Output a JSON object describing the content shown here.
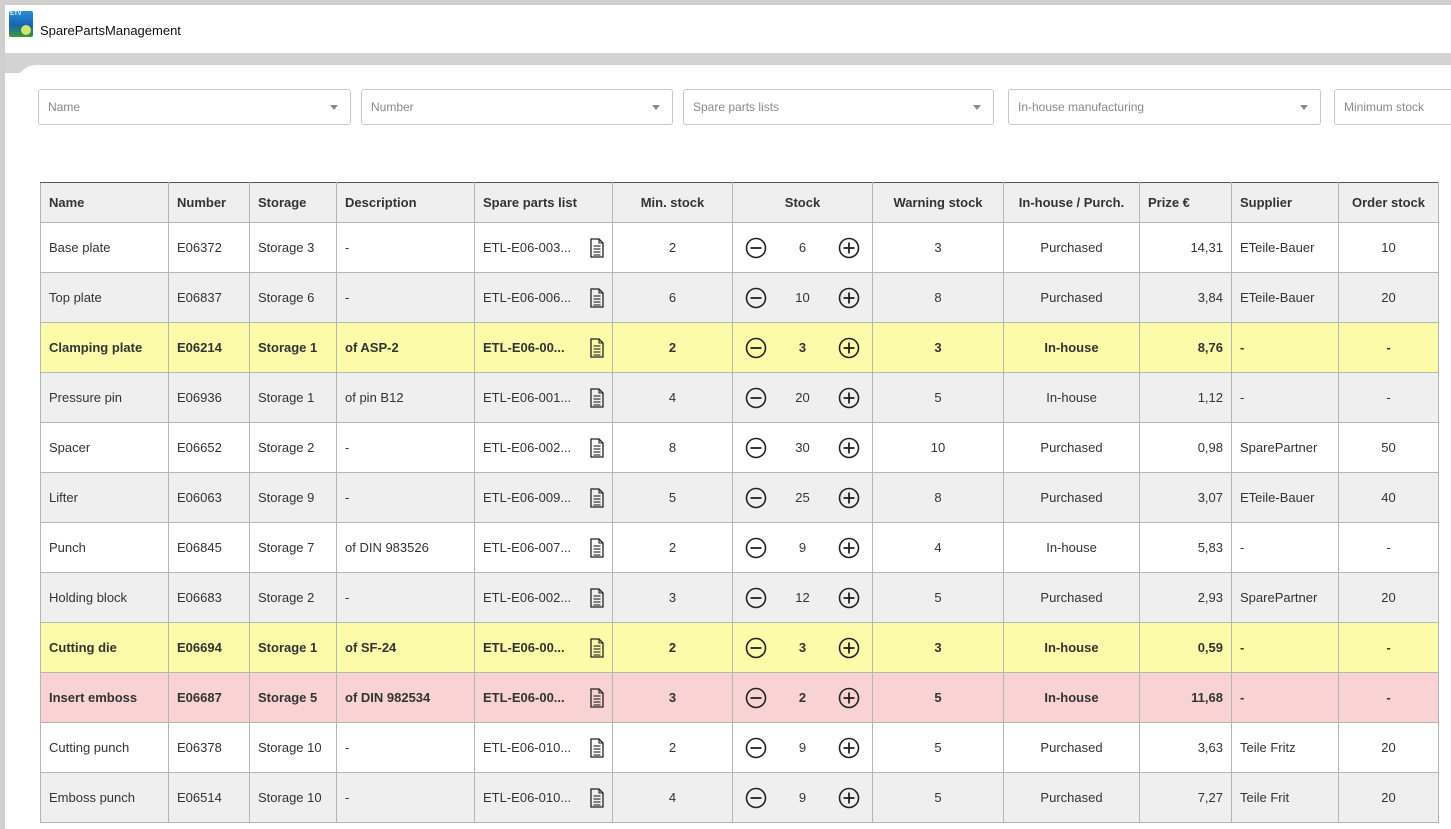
{
  "app": {
    "title": "SparePartsManagement",
    "icon_text": "ETV"
  },
  "filters": [
    {
      "placeholder": "Name"
    },
    {
      "placeholder": "Number"
    },
    {
      "placeholder": "Spare parts lists"
    },
    {
      "placeholder": "In-house manufacturing"
    },
    {
      "placeholder": "Minimum stock"
    }
  ],
  "table": {
    "headers": [
      "Name",
      "Number",
      "Storage",
      "Description",
      "Spare parts list",
      "Min. stock",
      "Stock",
      "Warning stock",
      "In-house / Purch.",
      "Prize €",
      "Supplier",
      "Order stock"
    ],
    "rows": [
      {
        "name": "Base plate",
        "number": "E06372",
        "storage": "Storage 3",
        "description": "-",
        "list": "ETL-E06-003...",
        "min": "2",
        "stock": "6",
        "warning": "3",
        "type": "Purchased",
        "price": "14,31",
        "supplier": "ETeile-Bauer",
        "order": "10",
        "status": "normal"
      },
      {
        "name": "Top plate",
        "number": "E06837",
        "storage": "Storage 6",
        "description": "-",
        "list": "ETL-E06-006...",
        "min": "6",
        "stock": "10",
        "warning": "8",
        "type": "Purchased",
        "price": "3,84",
        "supplier": "ETeile-Bauer",
        "order": "20",
        "status": "normal"
      },
      {
        "name": "Clamping plate",
        "number": "E06214",
        "storage": "Storage 1",
        "description": "of ASP-2",
        "list": "ETL-E06-00...",
        "min": "2",
        "stock": "3",
        "warning": "3",
        "type": "In-house",
        "price": "8,76",
        "supplier": "-",
        "order": "-",
        "status": "warning"
      },
      {
        "name": "Pressure pin",
        "number": "E06936",
        "storage": "Storage 1",
        "description": "of pin B12",
        "list": "ETL-E06-001...",
        "min": "4",
        "stock": "20",
        "warning": "5",
        "type": "In-house",
        "price": "1,12",
        "supplier": "-",
        "order": "-",
        "status": "normal"
      },
      {
        "name": "Spacer",
        "number": "E06652",
        "storage": "Storage 2",
        "description": "-",
        "list": "ETL-E06-002...",
        "min": "8",
        "stock": "30",
        "warning": "10",
        "type": "Purchased",
        "price": "0,98",
        "supplier": "SparePartner",
        "order": "50",
        "status": "normal"
      },
      {
        "name": "Lifter",
        "number": "E06063",
        "storage": "Storage 9",
        "description": "-",
        "list": "ETL-E06-009...",
        "min": "5",
        "stock": "25",
        "warning": "8",
        "type": "Purchased",
        "price": "3,07",
        "supplier": "ETeile-Bauer",
        "order": "40",
        "status": "normal"
      },
      {
        "name": "Punch",
        "number": "E06845",
        "storage": "Storage 7",
        "description": "of DIN 983526",
        "list": "ETL-E06-007...",
        "min": "2",
        "stock": "9",
        "warning": "4",
        "type": "In-house",
        "price": "5,83",
        "supplier": "-",
        "order": "-",
        "status": "normal"
      },
      {
        "name": "Holding block",
        "number": "E06683",
        "storage": "Storage 2",
        "description": "-",
        "list": "ETL-E06-002...",
        "min": "3",
        "stock": "12",
        "warning": "5",
        "type": "Purchased",
        "price": "2,93",
        "supplier": "SparePartner",
        "order": "20",
        "status": "normal"
      },
      {
        "name": "Cutting die",
        "number": "E06694",
        "storage": "Storage 1",
        "description": "of SF-24",
        "list": "ETL-E06-00...",
        "min": "2",
        "stock": "3",
        "warning": "3",
        "type": "In-house",
        "price": "0,59",
        "supplier": "-",
        "order": "-",
        "status": "warning"
      },
      {
        "name": "Insert emboss",
        "number": "E06687",
        "storage": "Storage 5",
        "description": "of DIN 982534",
        "list": "ETL-E06-00...",
        "min": "3",
        "stock": "2",
        "warning": "5",
        "type": "In-house",
        "price": "11,68",
        "supplier": "-",
        "order": "-",
        "status": "critical"
      },
      {
        "name": "Cutting punch",
        "number": "E06378",
        "storage": "Storage 10",
        "description": "-",
        "list": "ETL-E06-010...",
        "min": "2",
        "stock": "9",
        "warning": "5",
        "type": "Purchased",
        "price": "3,63",
        "supplier": "Teile Fritz",
        "order": "20",
        "status": "normal"
      },
      {
        "name": "Emboss punch",
        "number": "E06514",
        "storage": "Storage 10",
        "description": "-",
        "list": "ETL-E06-010...",
        "min": "4",
        "stock": "9",
        "warning": "5",
        "type": "Purchased",
        "price": "7,27",
        "supplier": "Teile Frit",
        "order": "20",
        "status": "normal"
      }
    ]
  },
  "colors": {
    "warning_row": "#fcfba9",
    "critical_row": "#f9d3d3",
    "alt_row": "#efefef"
  },
  "icons": {
    "document": "document-icon",
    "decrement": "minus-circle-icon",
    "increment": "plus-circle-icon",
    "dropdown": "chevron-down-icon"
  }
}
